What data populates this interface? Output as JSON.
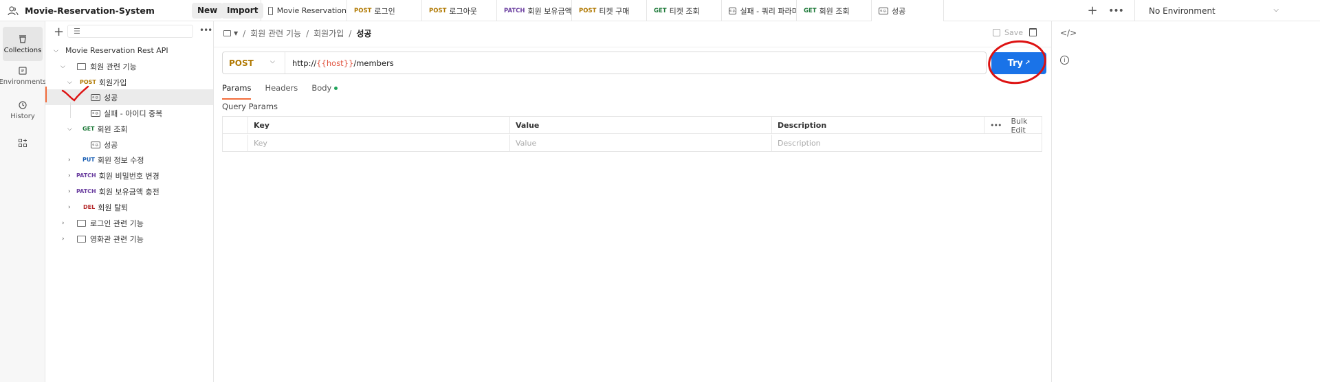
{
  "workspace": {
    "name": "Movie-Reservation-System",
    "new_label": "New",
    "import_label": "Import"
  },
  "tabs": [
    {
      "method": "",
      "label": "Movie Reservation",
      "type": "doc"
    },
    {
      "method": "POST",
      "label": "로그인"
    },
    {
      "method": "POST",
      "label": "로그아웃"
    },
    {
      "method": "PATCH",
      "label": "회원 보유금액 충"
    },
    {
      "method": "POST",
      "label": "티켓 구매"
    },
    {
      "method": "GET",
      "label": "티켓 조회"
    },
    {
      "method": "",
      "label": "실패 - 쿼리 파라미",
      "type": "example"
    },
    {
      "method": "GET",
      "label": "회원 조회"
    },
    {
      "method": "",
      "label": "성공",
      "type": "example",
      "active": true
    }
  ],
  "environment": {
    "label": "No Environment"
  },
  "rail": {
    "collections": "Collections",
    "environments": "Environments",
    "history": "History"
  },
  "tree": {
    "root": "Movie Reservation Rest API",
    "folder_member": "회원 관련 기능",
    "signup": {
      "method": "POST",
      "label": "회원가입"
    },
    "signup_success": "성공",
    "signup_fail": "실패 - 아이디 중복",
    "member_get": {
      "method": "GET",
      "label": "회원 조회"
    },
    "member_get_success": "성공",
    "member_update": {
      "method": "PUT",
      "label": "회원 정보 수정"
    },
    "member_pw": {
      "method": "PATCH",
      "label": "회원 비밀번호 변경"
    },
    "member_charge": {
      "method": "PATCH",
      "label": "회원 보유금액 충전"
    },
    "member_delete": {
      "method": "DEL",
      "label": "회원 탈퇴"
    },
    "folder_login": "로그인 관련 기능",
    "folder_theater": "영화관 관련 기능"
  },
  "breadcrumb": {
    "part1": "회원 관련 기능",
    "part2": "회원가입",
    "current": "성공"
  },
  "toolbar": {
    "save_label": "Save"
  },
  "request": {
    "method": "POST",
    "url_prefix": "http://",
    "url_var": "{{host}}",
    "url_suffix": "/members",
    "try_label": "Try",
    "try_arrow": "↗"
  },
  "request_tabs": {
    "params": "Params",
    "headers": "Headers",
    "body": "Body"
  },
  "query_params": {
    "title": "Query Params",
    "headers": {
      "key": "Key",
      "value": "Value",
      "description": "Description",
      "bulk_edit": "Bulk Edit"
    },
    "placeholders": {
      "key": "Key",
      "value": "Value",
      "description": "Description"
    }
  },
  "colors": {
    "accent": "#f26b3a",
    "try_button": "#1a73e8",
    "annotation": "#dd1111"
  }
}
